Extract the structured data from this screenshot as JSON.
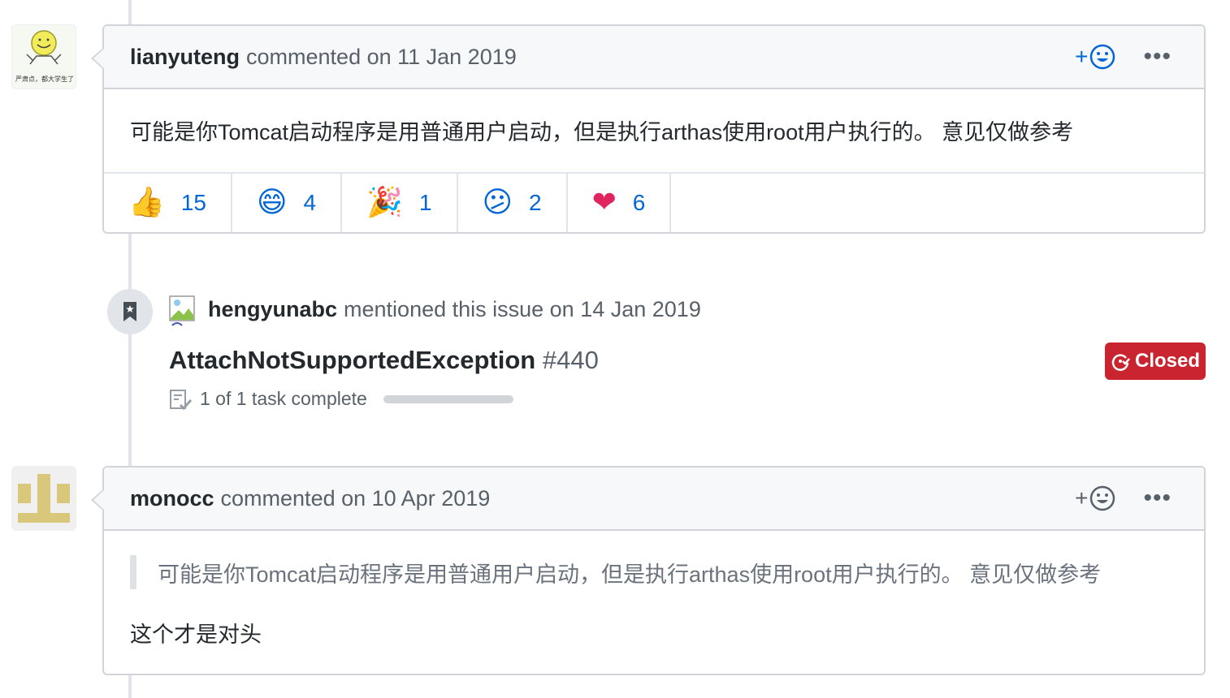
{
  "comment1": {
    "author": "lianyuteng",
    "meta": "commented on 11 Jan 2019",
    "avatar_caption": "严肃点，都大学生了",
    "body": "可能是你Tomcat启动程序是用普通用户启动，但是执行arthas使用root用户执行的。 意见仅做参考",
    "add_reaction": "+",
    "reactions": [
      {
        "emoji": "👍",
        "count": "15",
        "name": "thumbs-up"
      },
      {
        "emoji": "😄",
        "count": "4",
        "name": "laugh"
      },
      {
        "emoji": "🎉",
        "count": "1",
        "name": "hooray"
      },
      {
        "emoji": "😕",
        "count": "2",
        "name": "confused"
      },
      {
        "emoji": "❤",
        "count": "6",
        "name": "heart"
      }
    ]
  },
  "event": {
    "actor": "hengyunabc",
    "text": "mentioned this issue on 14 Jan 2019",
    "ref_title": "AttachNotSupportedException",
    "ref_number": "#440",
    "task_text": "1 of 1 task complete",
    "task_progress": 1.0,
    "state": "Closed"
  },
  "comment2": {
    "author": "monocc",
    "meta": "commented on 10 Apr 2019",
    "add_reaction": "+",
    "quote": "可能是你Tomcat启动程序是用普通用户启动，但是执行arthas使用root用户执行的。 意见仅做参考",
    "reply": "这个才是对头"
  },
  "colors": {
    "link": "#0366d6",
    "closed": "#cb2431",
    "border": "#d1d5da",
    "header_bg": "#f6f8fa"
  }
}
